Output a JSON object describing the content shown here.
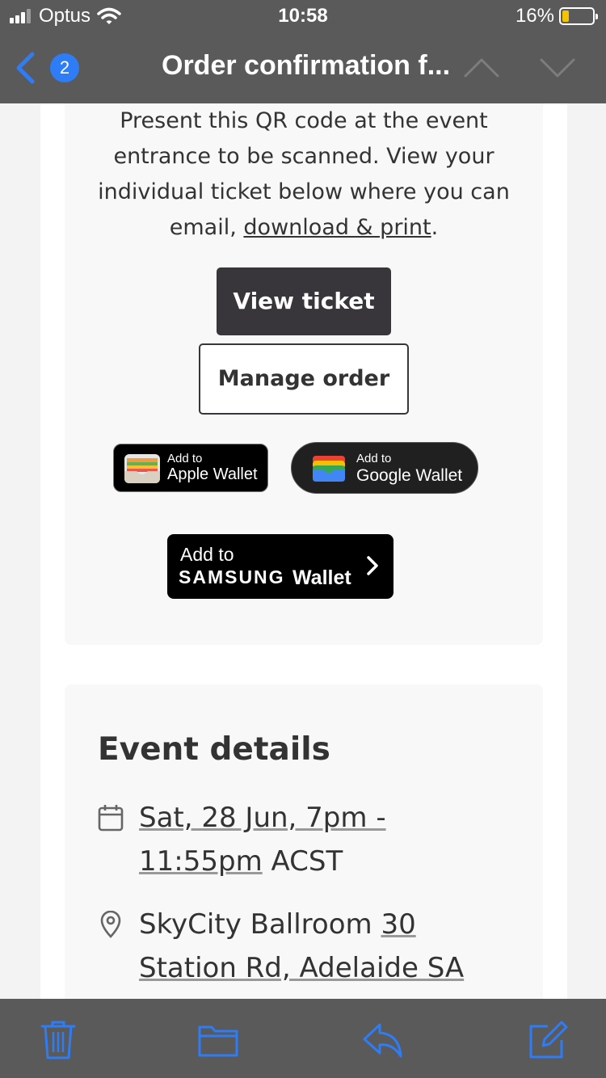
{
  "status_bar": {
    "carrier": "Optus",
    "time": "10:58",
    "battery": "16%",
    "battery_level": 0.16
  },
  "nav": {
    "back_badge": "2",
    "title": "Order confirmation f..."
  },
  "ticket_card": {
    "intro_text": "Present this QR code at the event entrance to be scanned. View your individual ticket below where you can email,",
    "intro_link": "download & print",
    "intro_end": ".",
    "view_ticket": "View ticket",
    "manage_order": "Manage order",
    "apple_wallet": {
      "small": "Add to",
      "big": "Apple Wallet"
    },
    "google_wallet": {
      "small": "Add to",
      "big": "Google Wallet"
    },
    "samsung_wallet": {
      "small": "Add to",
      "brand": "SAMSUNG",
      "wallet": "Wallet"
    }
  },
  "event_details": {
    "title": "Event details",
    "date_link": "Sat, 28 Jun, 7pm - 11:55pm",
    "date_suffix": "ACST",
    "venue_name": "SkyCity Ballroom",
    "venue_address": "30 Station Rd, Adelaide SA"
  },
  "colors": {
    "bars": "#5a5a5a",
    "accent": "#2e7cf6",
    "button_dark": "#39363b"
  },
  "icons": {
    "toolbar": [
      "trash-icon",
      "folder-icon",
      "reply-icon",
      "compose-icon"
    ]
  }
}
